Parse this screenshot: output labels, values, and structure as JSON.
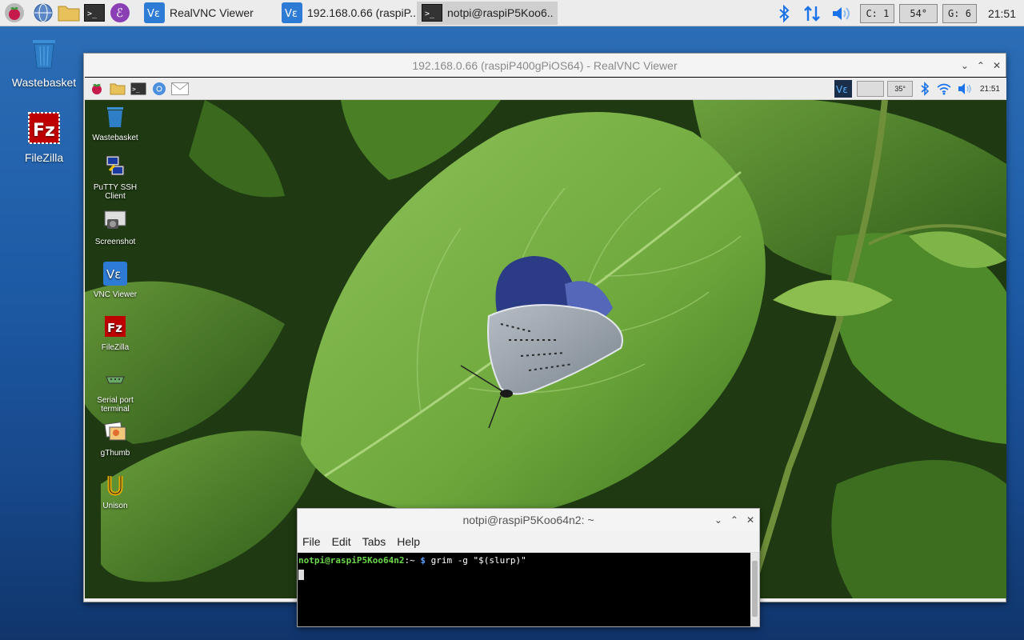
{
  "taskbar": {
    "tasks": [
      {
        "label": "RealVNC Viewer"
      },
      {
        "label": "192.168.0.66 (raspiP.."
      },
      {
        "label": "notpi@raspiP5Koo6.."
      }
    ],
    "cpu": "C:  1",
    "temp": "54°",
    "gpu": "G:  6",
    "clock": "21:51"
  },
  "desktop": {
    "icons": [
      {
        "label": "Wastebasket"
      },
      {
        "label": "FileZilla"
      }
    ]
  },
  "vnc": {
    "title": "192.168.0.66 (raspiP400gPiOS64) - RealVNC Viewer",
    "remote_tray": {
      "temp": "35°",
      "clock": "21:51"
    },
    "remote_icons": [
      {
        "label": "Wastebasket"
      },
      {
        "label": "PuTTY SSH Client"
      },
      {
        "label": "Screenshot"
      },
      {
        "label": "VNC Viewer"
      },
      {
        "label": "FileZilla"
      },
      {
        "label": "Serial port terminal"
      },
      {
        "label": "gThumb"
      },
      {
        "label": "Unison"
      }
    ]
  },
  "terminal": {
    "title": "notpi@raspiP5Koo64n2: ~",
    "menu": [
      "File",
      "Edit",
      "Tabs",
      "Help"
    ],
    "prompt_user": "notpi@raspiP5Koo64n2",
    "prompt_dir": ":~",
    "prompt_symbol": " $",
    "command": " grim -g \"$(slurp)\""
  },
  "colors": {
    "accent": "#1a73e8",
    "terminal_bg": "#000000",
    "prompt_green": "#6bd94a",
    "prompt_blue": "#5aa0ff"
  }
}
